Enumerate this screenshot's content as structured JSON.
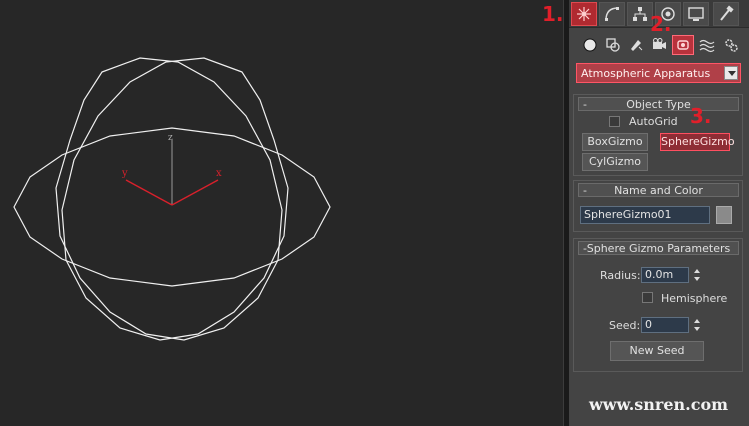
{
  "viewport": {
    "axis_labels": {
      "x": "x",
      "y": "y",
      "z": "z"
    }
  },
  "panel": {
    "tabs": [
      "create-tab",
      "modify-tab",
      "hierarchy-tab",
      "motion-tab",
      "display-tab",
      "utilities-tab"
    ],
    "subcategories": [
      "geometry",
      "shapes",
      "lights",
      "cameras",
      "helpers",
      "space-warps",
      "systems"
    ],
    "category_dropdown": "Atmospheric Apparatus",
    "object_type": {
      "title": "Object Type",
      "autogrid_label": "AutoGrid",
      "buttons": [
        "BoxGizmo",
        "SphereGizmo",
        "CylGizmo"
      ]
    },
    "name_color": {
      "title": "Name and Color",
      "name_value": "SphereGizmo01",
      "swatch_color": "#8a8a8a"
    },
    "params": {
      "title": "Sphere Gizmo Parameters",
      "radius_label": "Radius:",
      "radius_value": "0.0m",
      "hemisphere_label": "Hemisphere",
      "seed_label": "Seed:",
      "seed_value": "0",
      "new_seed_label": "New Seed"
    }
  },
  "markers": {
    "one": "1.",
    "two": "2.",
    "three": "3."
  },
  "watermark": "www.snren.com",
  "colors": {
    "accent": "#e01f2a",
    "highlight": "#b8323c"
  }
}
